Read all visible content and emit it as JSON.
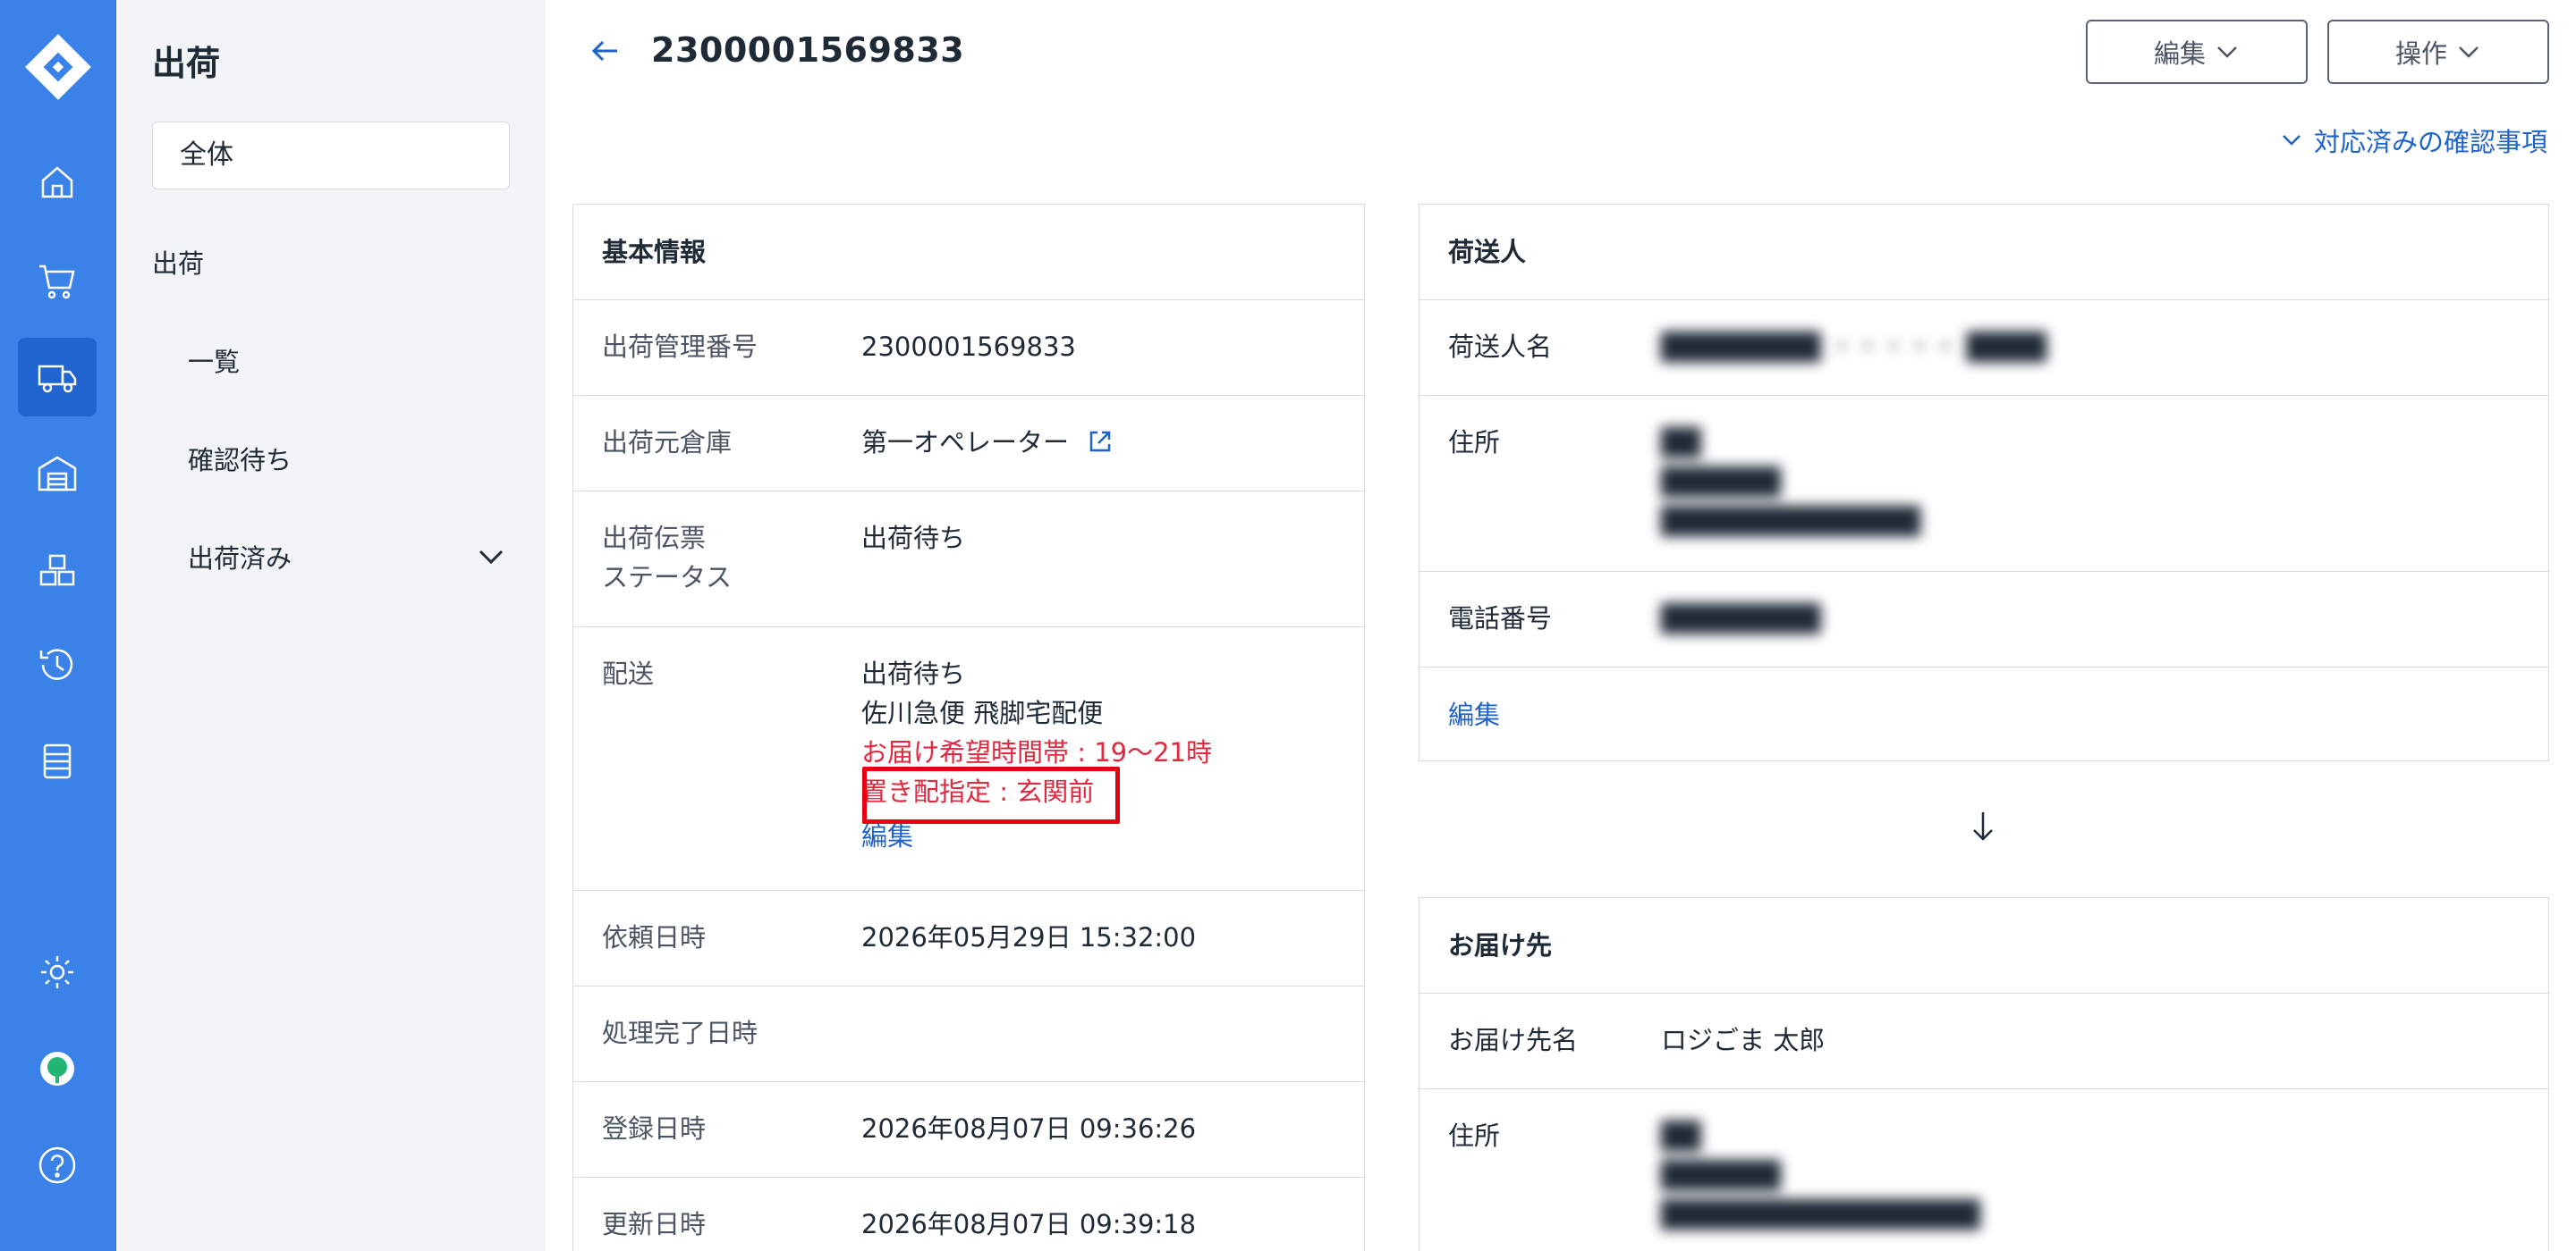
{
  "rail": {
    "items": [
      {
        "name": "home-icon"
      },
      {
        "name": "cart-icon"
      },
      {
        "name": "truck-icon"
      },
      {
        "name": "warehouse-icon"
      },
      {
        "name": "inventory-icon"
      },
      {
        "name": "history-icon"
      },
      {
        "name": "list-icon"
      },
      {
        "name": "gear-icon"
      },
      {
        "name": "status-icon"
      },
      {
        "name": "help-icon"
      }
    ],
    "accent": "#3b82e8",
    "active_color": "#1f64cf"
  },
  "subnav": {
    "title": "出荷",
    "scope": "全体",
    "section": "出荷",
    "items": [
      "一覧",
      "確認待ち",
      "出荷済み"
    ]
  },
  "header": {
    "title": "2300001569833",
    "edit_label": "編集",
    "ops_label": "操作",
    "confirm_link": "対応済みの確認事項"
  },
  "basic": {
    "heading": "基本情報",
    "rows": {
      "mgmt_no": {
        "label": "出荷管理番号",
        "value": "2300001569833"
      },
      "warehouse": {
        "label": "出荷元倉庫",
        "value": "第一オペレーター"
      },
      "status": {
        "label1": "出荷伝票",
        "label2": "ステータス",
        "value": "出荷待ち"
      },
      "delivery": {
        "label": "配送",
        "line1": "出荷待ち",
        "line2": "佐川急便 飛脚宅配便",
        "line3": "お届け希望時間帯 : 19〜21時",
        "line4": "置き配指定 : 玄関前",
        "edit": "編集"
      },
      "requested": {
        "label": "依頼日時",
        "value": "2026年05月29日 15:32:00"
      },
      "completed": {
        "label": "処理完了日時",
        "value": ""
      },
      "registered": {
        "label": "登録日時",
        "value": "2026年08月07日 09:36:26"
      },
      "updated": {
        "label": "更新日時",
        "value": "2026年08月07日 09:39:18"
      }
    }
  },
  "sender": {
    "heading": "荷送人",
    "name_label": "荷送人名",
    "address_label": "住所",
    "phone_label": "電話番号",
    "edit": "編集"
  },
  "recipient": {
    "heading": "お届け先",
    "name_label": "お届け先名",
    "name_value": "ロジごま 太郎",
    "address_label": "住所"
  }
}
